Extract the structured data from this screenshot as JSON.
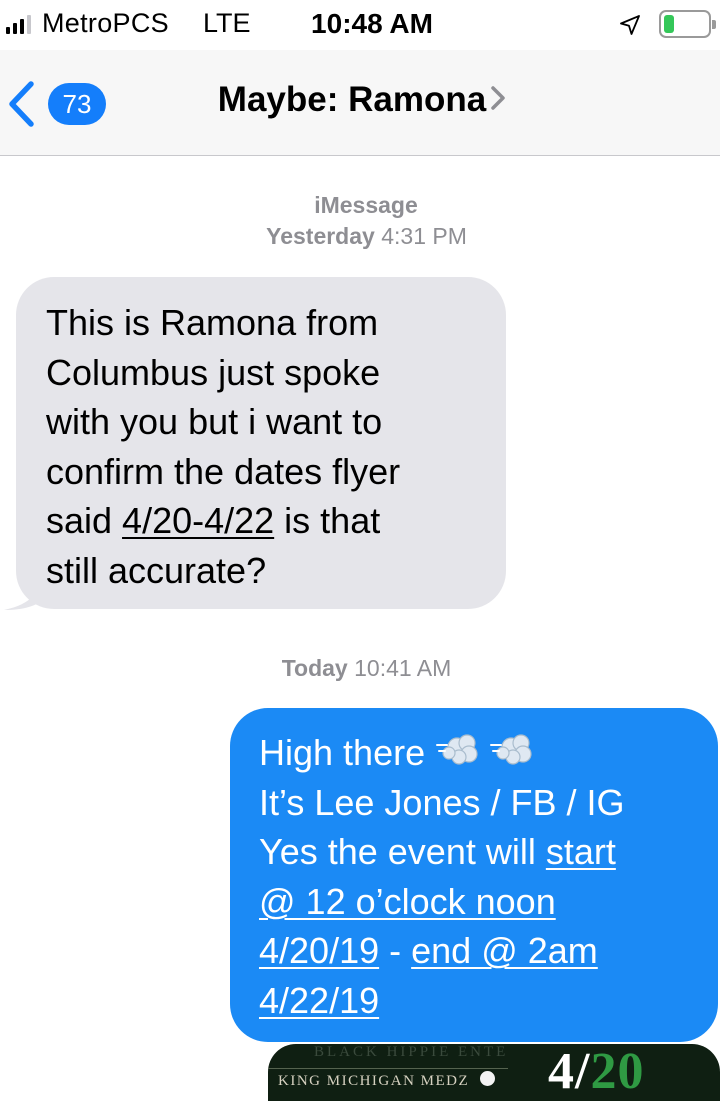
{
  "status_bar": {
    "carrier": "MetroPCS",
    "network": "LTE",
    "time": "10:48 AM",
    "battery_color": "#34c759"
  },
  "nav": {
    "back_count": "73",
    "title": "Maybe: Ramona",
    "accent": "#147efb"
  },
  "thread": {
    "service": "iMessage",
    "stamp1": {
      "day": "Yesterday",
      "time": "4:31 PM"
    },
    "incoming": {
      "lines": [
        "This is Ramona from",
        "Columbus just spoke",
        "with you but i want to",
        "confirm the dates flyer"
      ],
      "line5_pre": "said ",
      "line5_link": "4/20-4/22",
      "line5_post": " is that",
      "line6": "still accurate?",
      "bubble_color": "#e5e5ea"
    },
    "stamp2": {
      "day": "Today",
      "time": "10:41 AM"
    },
    "outgoing": {
      "line1": "High there",
      "emoji_icon": "dashing-away-emoji",
      "line2": "It’s Lee Jones / FB / IG",
      "line3_pre": "Yes the event will ",
      "line3_link": "start",
      "line4_link": "@ 12 o’clock noon",
      "line5_link_a": "4/20/19",
      "line5_sep": " - ",
      "line5_link_b": "end @ 2am",
      "line6_link": "4/22/19",
      "bubble_color": "#1b8af5"
    },
    "attachment": {
      "top_text": "BLACK HIPPIE ENTE",
      "sub_text": "KING MICHIGAN MEDZ",
      "date_a": "4/",
      "date_b": "20"
    }
  }
}
